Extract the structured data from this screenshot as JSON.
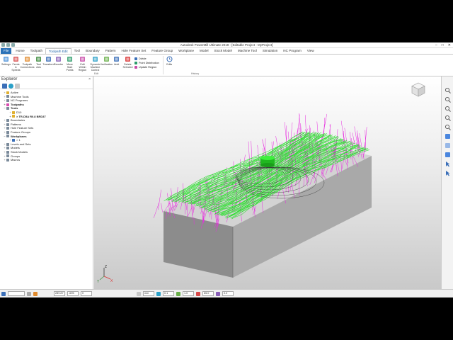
{
  "window": {
    "title": "Autodesk PowerMill Ultimate 2019 - [Editable Project - MyProject]",
    "controls": [
      "–",
      "□",
      "✕"
    ]
  },
  "ribbon_tabs": [
    {
      "label": "File",
      "kind": "file"
    },
    {
      "label": "Home",
      "kind": "normal"
    },
    {
      "label": "Toolpath",
      "kind": "normal"
    },
    {
      "label": "Toolpath Edit",
      "kind": "active"
    },
    {
      "label": "Tool",
      "kind": "normal"
    },
    {
      "label": "Boundary",
      "kind": "normal"
    },
    {
      "label": "Pattern",
      "kind": "normal"
    },
    {
      "label": "Hole Feature Set",
      "kind": "normal"
    },
    {
      "label": "Feature Group",
      "kind": "normal"
    },
    {
      "label": "Workplane",
      "kind": "normal"
    },
    {
      "label": "Model",
      "kind": "normal"
    },
    {
      "label": "Stock Model",
      "kind": "normal"
    },
    {
      "label": "Machine Tool",
      "kind": "normal"
    },
    {
      "label": "Simulation",
      "kind": "normal"
    },
    {
      "label": "NC Program",
      "kind": "normal"
    },
    {
      "label": "View",
      "kind": "normal"
    }
  ],
  "ribbon": {
    "buttons": [
      {
        "label": "Settings",
        "icon": "settings-icon",
        "color": "#4a90d9"
      },
      {
        "label": "Feeds & Speeds",
        "icon": "feeds-speeds-icon",
        "color": "#d94a4a"
      },
      {
        "label": "Toolpath Connections",
        "icon": "connections-icon",
        "color": "#e08a2c"
      },
      {
        "label": "Tool Axis",
        "icon": "tool-axis-icon",
        "color": "#3b8a3b"
      },
      {
        "label": "Transform",
        "icon": "transform-icon",
        "color": "#3b6fb8"
      },
      {
        "label": "Reorder",
        "icon": "reorder-icon",
        "color": "#8a5fb8"
      },
      {
        "label": "Move Start Points",
        "icon": "move-start-icon",
        "color": "#2c9c6a"
      },
      {
        "label": "Edit Within Region",
        "icon": "edit-region-icon",
        "color": "#c94aa8"
      },
      {
        "label": "Dynamic Machine Control",
        "icon": "dynamic-control-icon",
        "color": "#2aa0c8"
      },
      {
        "label": "Verification",
        "icon": "verification-icon",
        "color": "#6ab04a"
      },
      {
        "label": "Limit",
        "icon": "limit-icon",
        "color": "#3b6fb8"
      },
      {
        "label": "Delete Selected",
        "icon": "delete-icon",
        "color": "#d93030"
      }
    ],
    "small_buttons": [
      {
        "label": "Divide",
        "color": "#3b6fb8"
      },
      {
        "label": "Point Distribution",
        "color": "#2c9c6a"
      },
      {
        "label": "Update Region",
        "color": "#c94aa8"
      }
    ],
    "edits_button": {
      "label": "Edits",
      "icon": "edits-icon",
      "color": "#3b6fb8"
    },
    "group_labels": [
      "Edit",
      "History"
    ]
  },
  "explorer": {
    "title": "Explorer",
    "close": "×",
    "items": [
      {
        "label": "Active",
        "level": 1,
        "expander": "+",
        "icon_color": "#e0b030",
        "bold": false
      },
      {
        "label": "Machine Tools",
        "level": 1,
        "expander": "+",
        "icon_color": "#7a8a9a",
        "bold": false
      },
      {
        "label": "NC Programs",
        "level": 1,
        "expander": "+",
        "icon_color": "#7a8a9a",
        "bold": false
      },
      {
        "label": "Toolpaths",
        "level": 1,
        "expander": "+",
        "icon_color": "#d94ab0",
        "bold": true
      },
      {
        "label": "Tools",
        "level": 1,
        "expander": "−",
        "icon_color": "#7a8a9a",
        "bold": true
      },
      {
        "label": "D10",
        "level": 2,
        "expander": "+",
        "icon_color": "#e0b030",
        "bold": false
      },
      {
        "label": "> TR-D5A R0.8 BRD37",
        "level": 2,
        "expander": "+",
        "icon_color": "#e0b030",
        "bold": true
      },
      {
        "label": "Boundaries",
        "level": 1,
        "expander": "+",
        "icon_color": "#7a8a9a",
        "bold": false
      },
      {
        "label": "Patterns",
        "level": 1,
        "expander": "+",
        "icon_color": "#7a8a9a",
        "bold": false
      },
      {
        "label": "Hole Feature Sets",
        "level": 1,
        "expander": "+",
        "icon_color": "#7a8a9a",
        "bold": false
      },
      {
        "label": "Feature Groups",
        "level": 1,
        "expander": "+",
        "icon_color": "#7a8a9a",
        "bold": false
      },
      {
        "label": "Workplanes",
        "level": 1,
        "expander": "−",
        "icon_color": "#7a8a9a",
        "bold": true
      },
      {
        "label": "> 1",
        "level": 2,
        "expander": "+",
        "icon_color": "#3b6fb8",
        "bold": false
      },
      {
        "label": "Levels and Sets",
        "level": 1,
        "expander": "+",
        "icon_color": "#7a8a9a",
        "bold": false
      },
      {
        "label": "Models",
        "level": 1,
        "expander": "+",
        "icon_color": "#7a8a9a",
        "bold": false
      },
      {
        "label": "Stock Models",
        "level": 1,
        "expander": "+",
        "icon_color": "#7a8a9a",
        "bold": false
      },
      {
        "label": "Groups",
        "level": 1,
        "expander": "+",
        "icon_color": "#7a8a9a",
        "bold": false
      },
      {
        "label": "Macros",
        "level": 1,
        "expander": "+",
        "icon_color": "#7a8a9a",
        "bold": false
      }
    ]
  },
  "viewport": {
    "axis_labels": {
      "z": "Z",
      "x": "X",
      "y": "Y"
    },
    "colors": {
      "toolpath_green": "#27e02a",
      "toolpath_magenta": "#e82ee0",
      "block_top": "#d3d3d3",
      "block_front": "#8c8c8c",
      "block_side": "#a9a9a9",
      "tool": "#22cc22"
    }
  },
  "right_toolbar": [
    {
      "icon": "zoom-icon"
    },
    {
      "icon": "rotate-icon"
    },
    {
      "icon": "pan-icon"
    },
    {
      "icon": "zoom-in-icon"
    },
    {
      "icon": "zoom-out-icon"
    },
    {
      "icon": "shaded-view-icon"
    },
    {
      "icon": "wireframe-icon"
    },
    {
      "icon": "iso-view-icon"
    },
    {
      "icon": "select-icon"
    },
    {
      "icon": "pointer-icon"
    }
  ],
  "status": {
    "fields": [
      "289.87",
      "-695",
      "0"
    ],
    "units": "mm",
    "tolerance": "0.1",
    "stepover": "1.0",
    "thickness": "65.0",
    "zero": "0.0"
  }
}
